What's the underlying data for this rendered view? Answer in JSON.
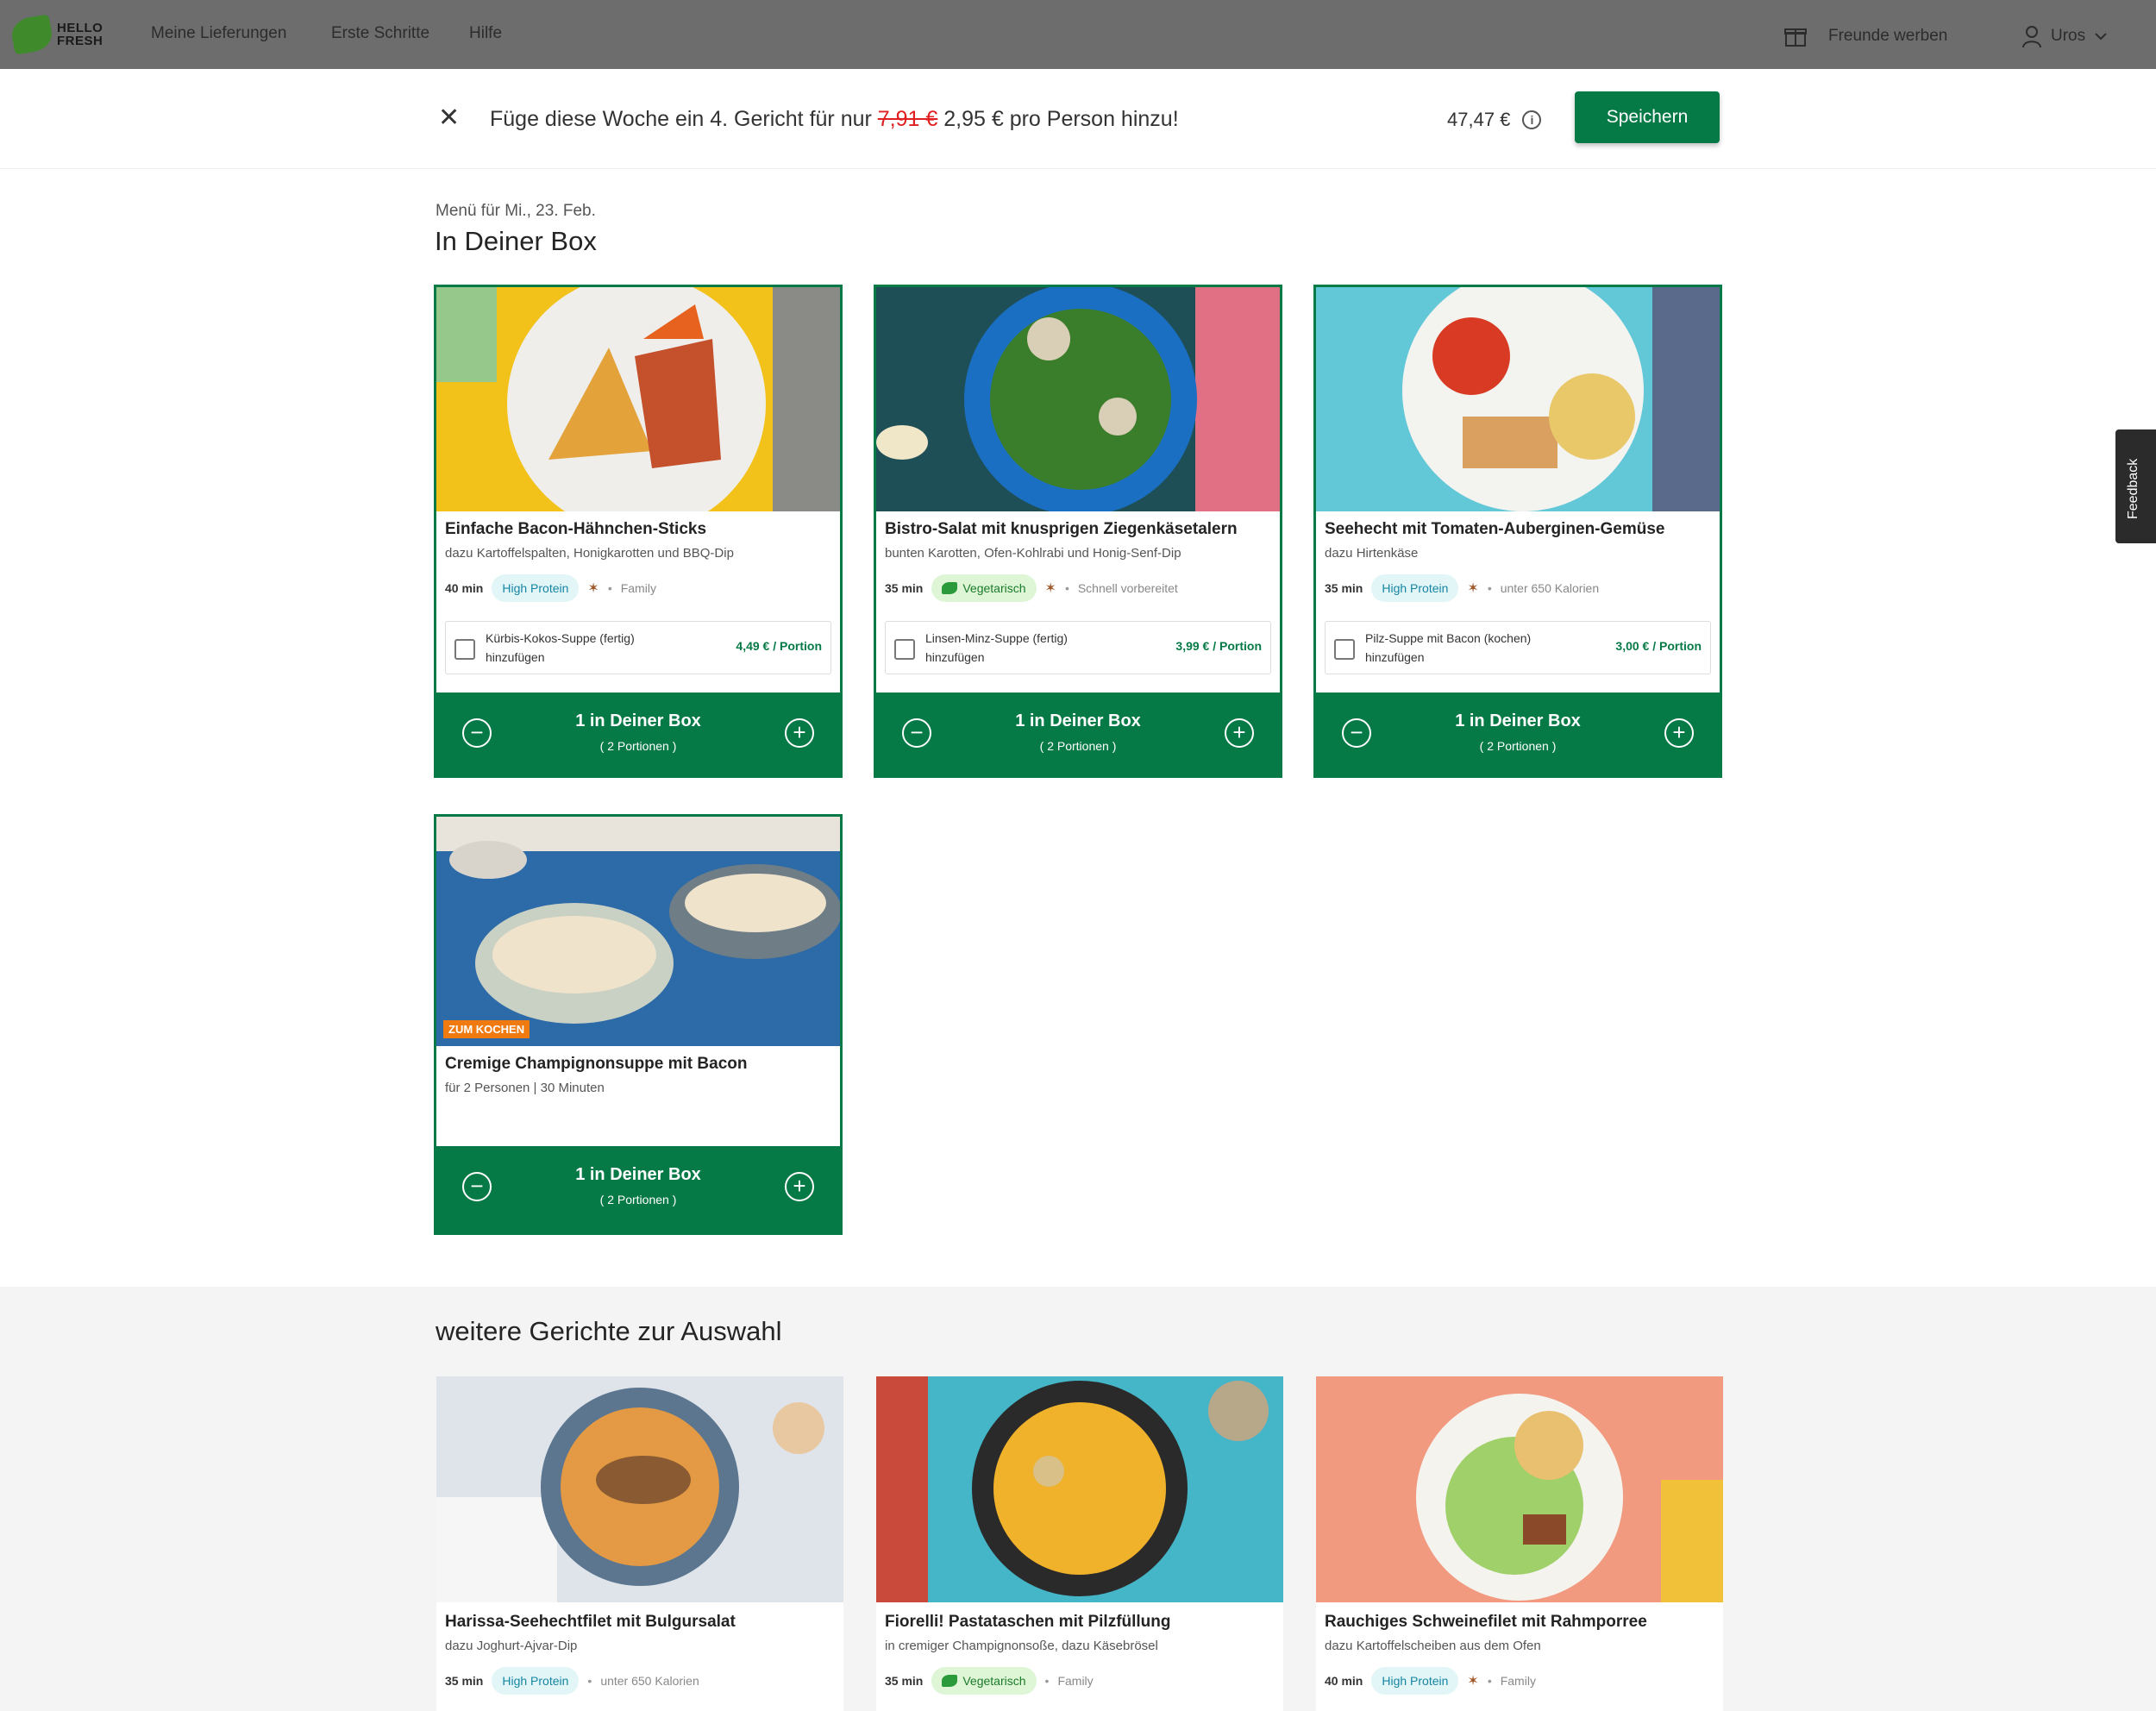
{
  "nav": {
    "logo_line1": "HELLO",
    "logo_line2": "FRESH",
    "links": [
      "Meine Lieferungen",
      "Erste Schritte",
      "Hilfe"
    ],
    "refer": "Freunde werben",
    "user": "Uros"
  },
  "banner": {
    "text_before": "Füge diese Woche ein 4. Gericht für nur ",
    "old_price": "7,91 €",
    "text_after": " 2,95 € pro Person hinzu!",
    "total": "47,47 €",
    "info": "i",
    "save_label": "Speichern"
  },
  "menu": {
    "date": "Menü für Mi., 23. Feb.",
    "title": "In Deiner Box"
  },
  "box_cards": [
    {
      "title": "Einfache Bacon-Hähnchen-Sticks",
      "subtitle": "dazu Kartoffelspalten, Honigkarotten und BBQ-Dip",
      "time": "40 min",
      "tag": "High Protein",
      "extra": "Family",
      "addon_text": "Kürbis-Kokos-Suppe (fertig) hinzufügen",
      "addon_price": "4,49 € / Portion",
      "count_label": "1 in Deiner Box",
      "portions": "( 2 Portionen )"
    },
    {
      "title": "Bistro-Salat mit knusprigen Ziegenkäsetalern",
      "subtitle": "bunten Karotten, Ofen-Kohlrabi und Honig-Senf-Dip",
      "time": "35 min",
      "tag": "Vegetarisch",
      "extra": "Schnell vorbereitet",
      "addon_text": "Linsen-Minz-Suppe (fertig) hinzufügen",
      "addon_price": "3,99 € / Portion",
      "count_label": "1 in Deiner Box",
      "portions": "( 2 Portionen )"
    },
    {
      "title": "Seehecht mit Tomaten-Auberginen-Gemüse",
      "subtitle": "dazu Hirtenkäse",
      "time": "35 min",
      "tag": "High Protein",
      "extra": "unter 650 Kalorien",
      "addon_text": "Pilz-Suppe mit Bacon (kochen) hinzufügen",
      "addon_price": "3,00 € / Portion",
      "count_label": "1 in Deiner Box",
      "portions": "( 2 Portionen )"
    }
  ],
  "soup_card": {
    "badge": "ZUM KOCHEN",
    "title": "Cremige Champignonsuppe mit Bacon",
    "subtitle": "für 2 Personen | 30 Minuten",
    "count_label": "1 in Deiner Box",
    "portions": "( 2 Portionen )"
  },
  "feedback": "Feedback",
  "more": {
    "title": "weitere Gerichte zur Auswahl",
    "cards": [
      {
        "title": "Harissa-Seehechtfilet mit Bulgursalat",
        "subtitle": "dazu Joghurt-Ajvar-Dip",
        "time": "35 min",
        "tag": "High Protein",
        "extra": "unter 650 Kalorien"
      },
      {
        "title": "Fiorelli! Pastataschen mit Pilzfüllung",
        "subtitle": "in cremiger Champignonsoße, dazu Käsebrösel",
        "time": "35 min",
        "tag": "Vegetarisch",
        "extra": "Family"
      },
      {
        "title": "Rauchiges Schweinefilet mit Rahmporree",
        "subtitle": "dazu Kartoffelscheiben aus dem Ofen",
        "time": "40 min",
        "tag": "High Protein",
        "extra": "Family"
      }
    ]
  },
  "icons": {
    "close": "close-icon",
    "gift": "gift-icon",
    "user": "user-icon",
    "chevron": "chevron-down-icon",
    "minus": "minus-icon",
    "plus": "plus-icon",
    "leaf": "leaf-icon",
    "dish": "dish-icon"
  },
  "colors": {
    "brand_green": "#067a46",
    "badge_orange": "#f07a10",
    "strike_red": "#e02020"
  }
}
